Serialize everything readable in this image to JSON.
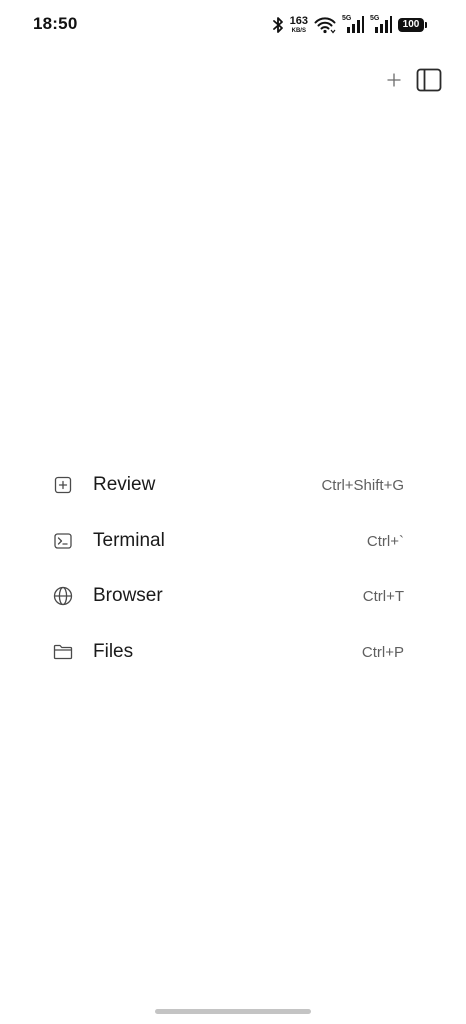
{
  "status_bar": {
    "time": "18:50",
    "net_speed_value": "163",
    "net_speed_unit": "KB/S",
    "sim1_tag": "5G",
    "sim2_tag": "5G",
    "battery_level": "100",
    "icons": [
      "bluetooth-icon",
      "wifi-icon",
      "signal-icon",
      "battery-icon"
    ]
  },
  "toolbar": {
    "add_icon": "plus-icon",
    "sidebar_icon": "sidebar-panel-icon"
  },
  "menu": {
    "items": [
      {
        "label": "Review",
        "shortcut": "Ctrl+Shift+G",
        "icon": "plus-square-icon"
      },
      {
        "label": "Terminal",
        "shortcut": "Ctrl+`",
        "icon": "terminal-icon"
      },
      {
        "label": "Browser",
        "shortcut": "Ctrl+T",
        "icon": "globe-icon"
      },
      {
        "label": "Files",
        "shortcut": "Ctrl+P",
        "icon": "folder-icon"
      }
    ]
  },
  "colors": {
    "background": "#ffffff",
    "text_primary": "#1a1a1a",
    "text_secondary": "#5f5f5f",
    "home_indicator": "#c4c4c4"
  }
}
